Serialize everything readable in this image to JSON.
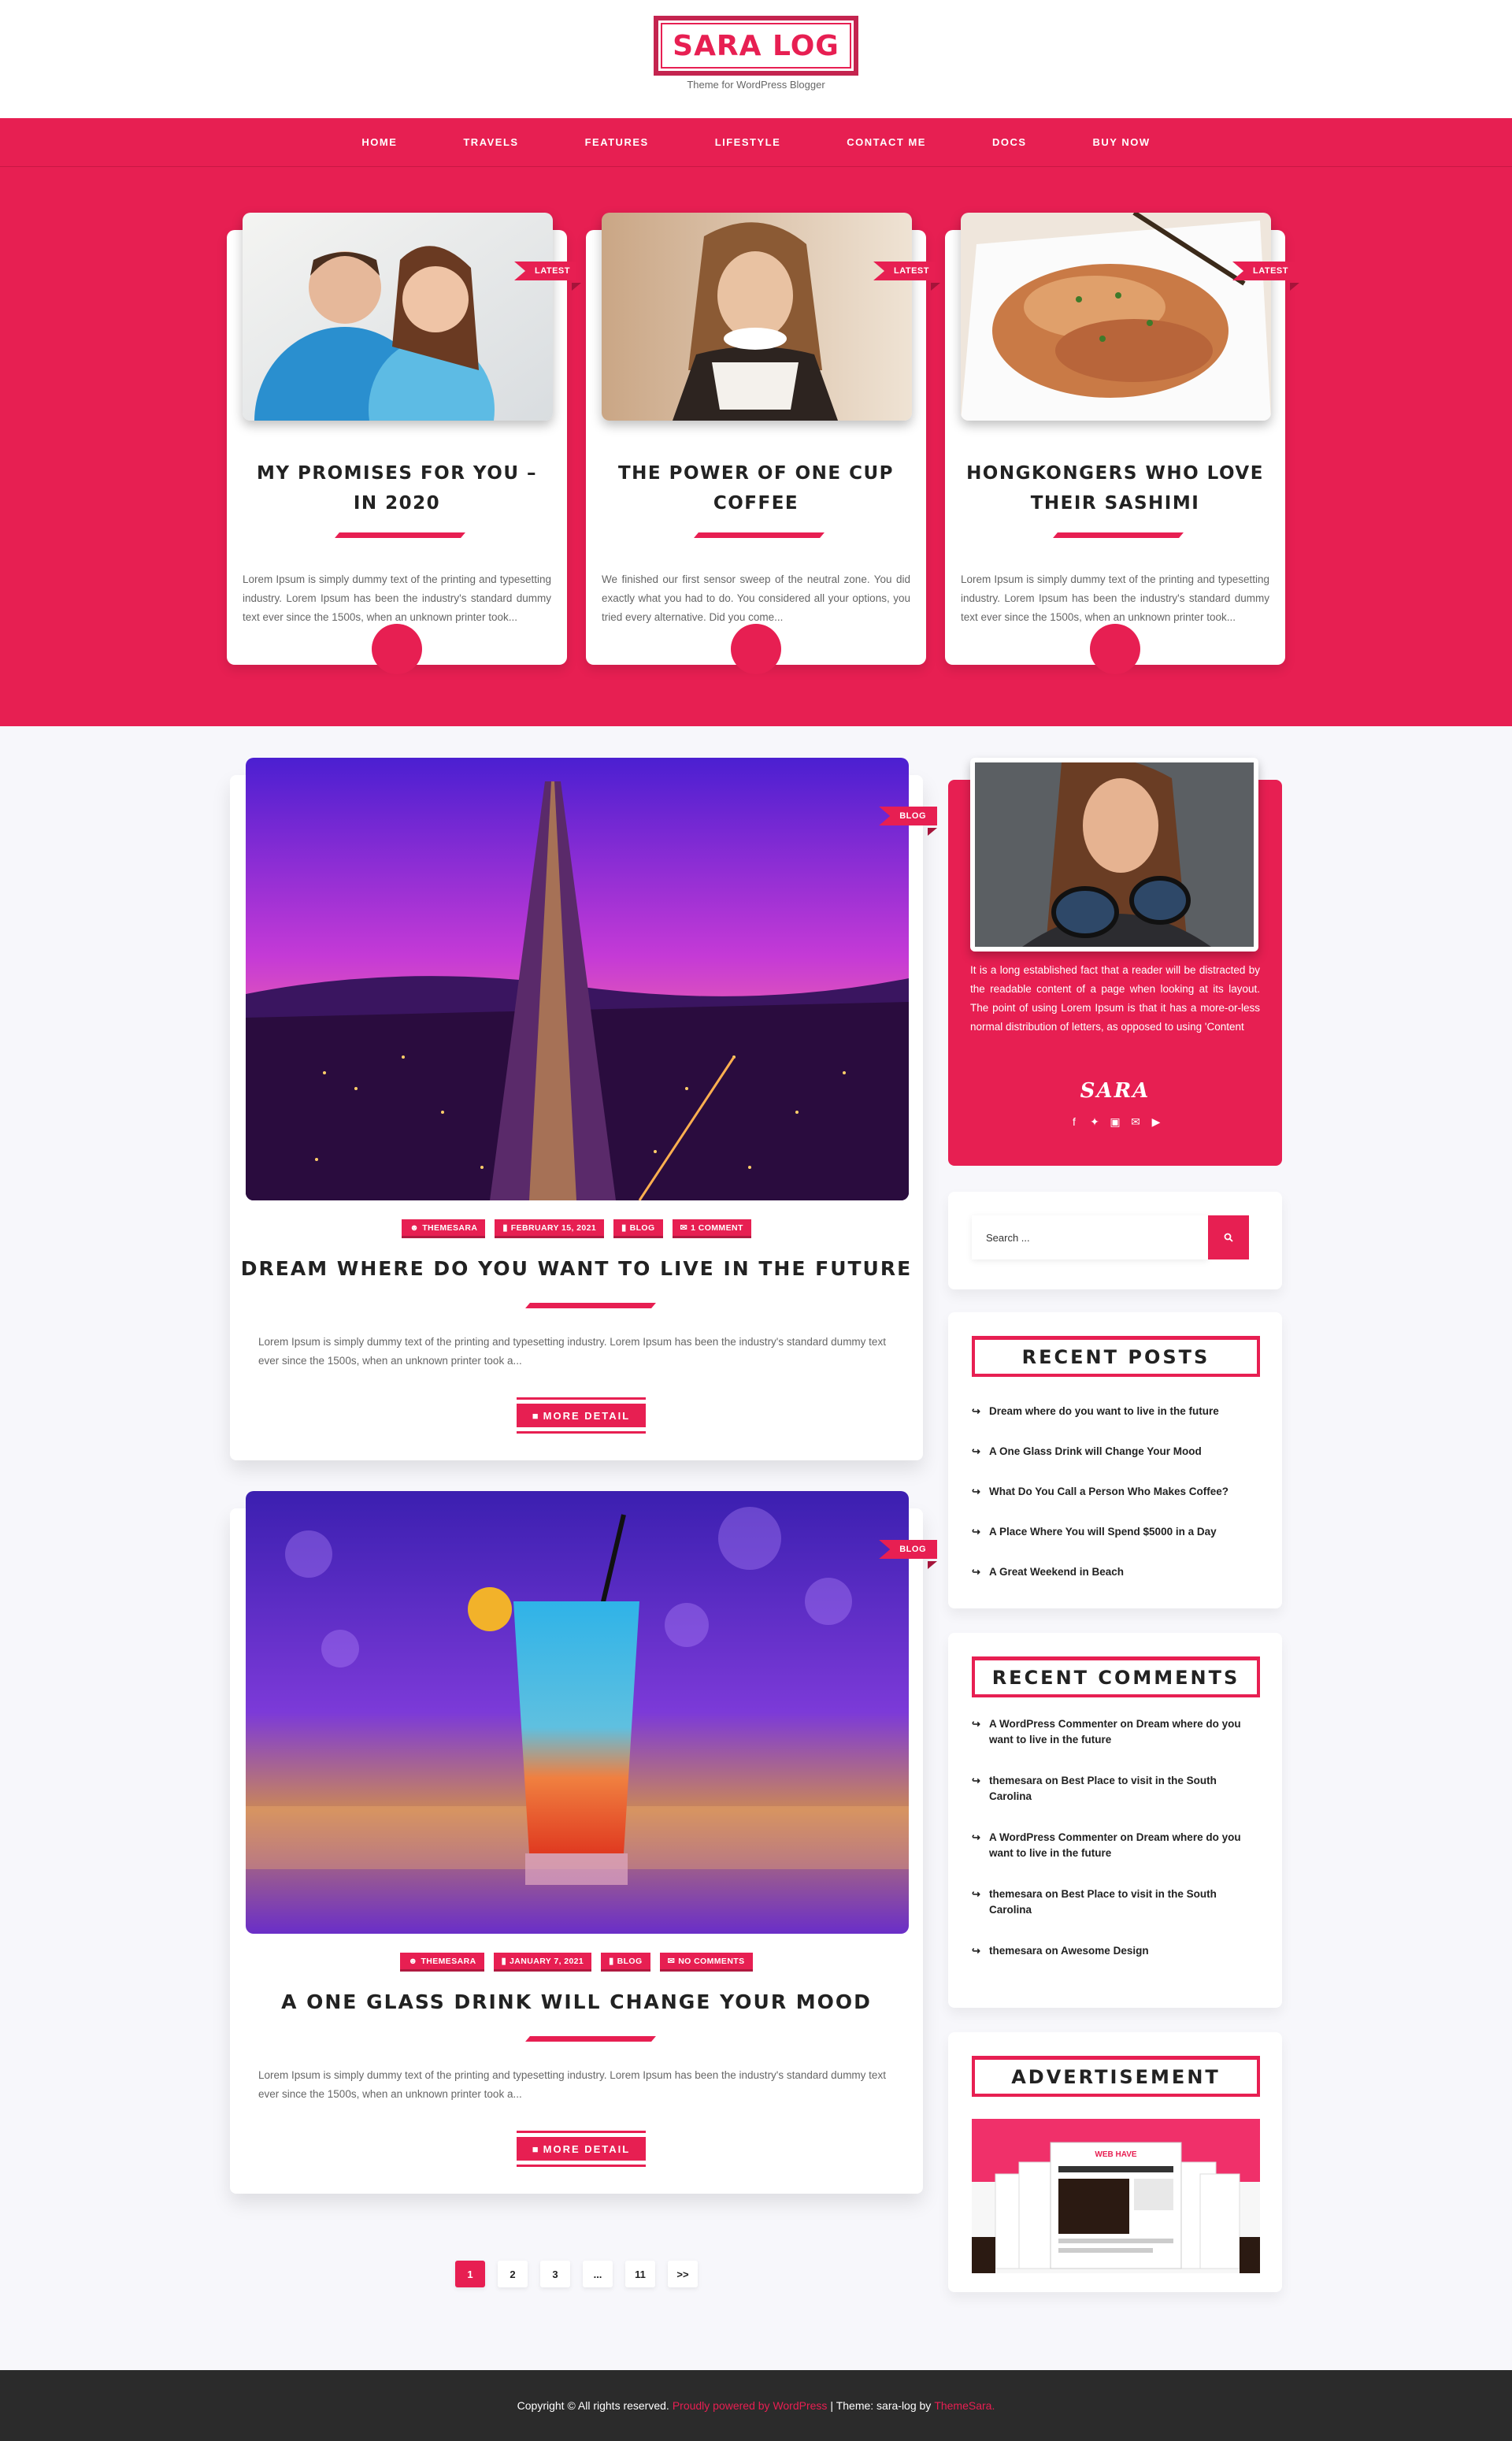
{
  "site": {
    "title": "SARA LOG",
    "tagline": "Theme for WordPress Blogger"
  },
  "nav": [
    "HOME",
    "TRAVELS",
    "FEATURES",
    "LIFESTYLE",
    "CONTACT ME",
    "DOCS",
    "BUY NOW"
  ],
  "featured": [
    {
      "ribbon": "LATEST",
      "title": "MY PROMISES FOR YOU – IN 2020",
      "excerpt": "Lorem Ipsum is simply dummy text of the printing and typesetting industry. Lorem Ipsum has been the industry's standard dummy text ever since the 1500s, when an unknown printer took..."
    },
    {
      "ribbon": "LATEST",
      "title": "THE POWER OF ONE CUP COFFEE",
      "excerpt": "We finished our first sensor sweep of the neutral zone. You did exactly what you had to do. You considered all your options, you tried every alternative. Did you come..."
    },
    {
      "ribbon": "LATEST",
      "title": "HONGKONGERS WHO LOVE THEIR SASHIMI",
      "excerpt": "Lorem Ipsum is simply dummy text of the printing and typesetting industry. Lorem Ipsum has been the industry's standard dummy text ever since the 1500s, when an unknown printer took..."
    }
  ],
  "posts": [
    {
      "ribbon": "BLOG",
      "meta": {
        "author": "THEMESARA",
        "date": "FEBRUARY 15, 2021",
        "category": "BLOG",
        "comments": "1 COMMENT"
      },
      "title": "DREAM WHERE DO YOU WANT TO LIVE IN THE FUTURE",
      "excerpt": "Lorem Ipsum is simply dummy text of the printing and typesetting industry. Lorem Ipsum has been the industry's standard dummy text ever since the 1500s, when an unknown printer took a...",
      "more": "MORE DETAIL"
    },
    {
      "ribbon": "BLOG",
      "meta": {
        "author": "THEMESARA",
        "date": "JANUARY 7, 2021",
        "category": "BLOG",
        "comments": "NO COMMENTS"
      },
      "title": "A ONE GLASS DRINK WILL CHANGE YOUR MOOD",
      "excerpt": "Lorem Ipsum is simply dummy text of the printing and typesetting industry. Lorem Ipsum has been the industry's standard dummy text ever since the 1500s, when an unknown printer took a...",
      "more": "MORE DETAIL"
    }
  ],
  "about": {
    "text": "It is a long established fact that a reader will be distracted by the readable content of a page when looking at its layout. The point of using Lorem Ipsum is that it has a more-or-less normal distribution of letters, as opposed to using 'Content",
    "name": "SARA"
  },
  "search": {
    "placeholder": "Search ..."
  },
  "recent_posts": {
    "title": "RECENT POSTS",
    "items": [
      "Dream where do you want to live in the future",
      "A One Glass Drink will Change Your Mood",
      "What Do You Call a Person Who Makes Coffee?",
      "A Place Where You will Spend $5000 in a Day",
      "A Great Weekend in Beach"
    ]
  },
  "recent_comments": {
    "title": "RECENT COMMENTS",
    "items": [
      "A WordPress Commenter on Dream where do you want to live in the future",
      "themesara on Best Place to visit in the South Carolina",
      "A WordPress Commenter on Dream where do you want to live in the future",
      "themesara on Best Place to visit in the South Carolina",
      "themesara on Awesome Design"
    ]
  },
  "advertisement": {
    "title": "ADVERTISEMENT",
    "ad_label": "WEB HAVE"
  },
  "pagination": [
    "1",
    "2",
    "3",
    "...",
    "11",
    ">>"
  ],
  "footer": {
    "copyright": "Copyright © All rights reserved.",
    "powered": "Proudly powered by WordPress",
    "theme": "| Theme: sara-log by",
    "author": "ThemeSara."
  },
  "colors": {
    "accent": "#e71f52",
    "footer_bg": "#2b2b2b"
  }
}
